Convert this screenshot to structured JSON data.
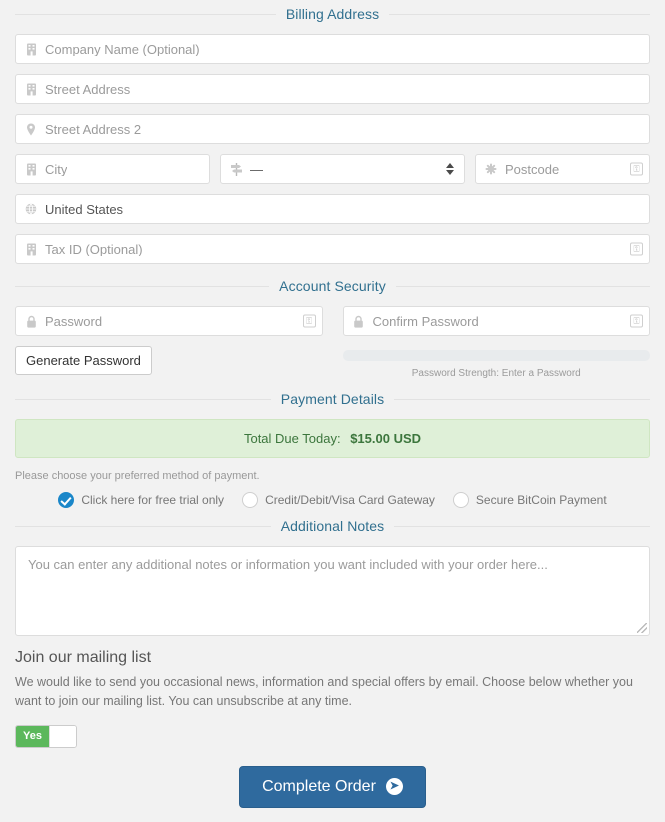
{
  "sections": {
    "billing": "Billing Address",
    "security": "Account Security",
    "payment": "Payment Details",
    "notes": "Additional Notes"
  },
  "billing": {
    "company": {
      "placeholder": "Company Name (Optional)",
      "icon": "building-icon"
    },
    "street1": {
      "placeholder": "Street Address",
      "icon": "building-icon"
    },
    "street2": {
      "placeholder": "Street Address 2",
      "icon": "map-marker-icon"
    },
    "city": {
      "placeholder": "City",
      "icon": "building-icon"
    },
    "state": {
      "value": "—",
      "icon": "map-signs-icon"
    },
    "postcode": {
      "placeholder": "Postcode",
      "icon": "asterisk-icon"
    },
    "country": {
      "value": "United States",
      "icon": "globe-icon"
    },
    "taxid": {
      "placeholder": "Tax ID (Optional)",
      "icon": "building-icon"
    }
  },
  "security": {
    "password": {
      "placeholder": "Password",
      "icon": "lock-icon"
    },
    "confirm": {
      "placeholder": "Confirm Password",
      "icon": "lock-icon"
    },
    "generate_label": "Generate Password",
    "strength_text": "Password Strength: Enter a Password",
    "strength_percent": 0
  },
  "payment": {
    "total_label": "Total Due Today:",
    "total_amount": "$15.00 USD",
    "helper": "Please choose your preferred method of payment.",
    "methods": [
      {
        "label": "Click here for free trial only",
        "selected": true
      },
      {
        "label": "Credit/Debit/Visa Card Gateway",
        "selected": false
      },
      {
        "label": "Secure BitCoin Payment",
        "selected": false
      }
    ]
  },
  "notes": {
    "placeholder": "You can enter any additional notes or information you want included with your order here...",
    "value": ""
  },
  "mailing": {
    "title": "Join our mailing list",
    "description": "We would like to send you occasional news, information and special offers by email. Choose below whether you want to join our mailing list. You can unsubscribe at any time.",
    "toggle_label": "Yes",
    "toggle_on": true
  },
  "submit": {
    "label": "Complete Order",
    "icon": "arrow-circle-right-icon"
  },
  "colors": {
    "page_bg": "#f2f2f2",
    "legend": "#31708f",
    "primary": "#2f6a9e",
    "success_bg": "#dff0d8",
    "success_text": "#3c763d",
    "toggle_on": "#5cb85c",
    "radio_checked": "#1b87c9"
  }
}
